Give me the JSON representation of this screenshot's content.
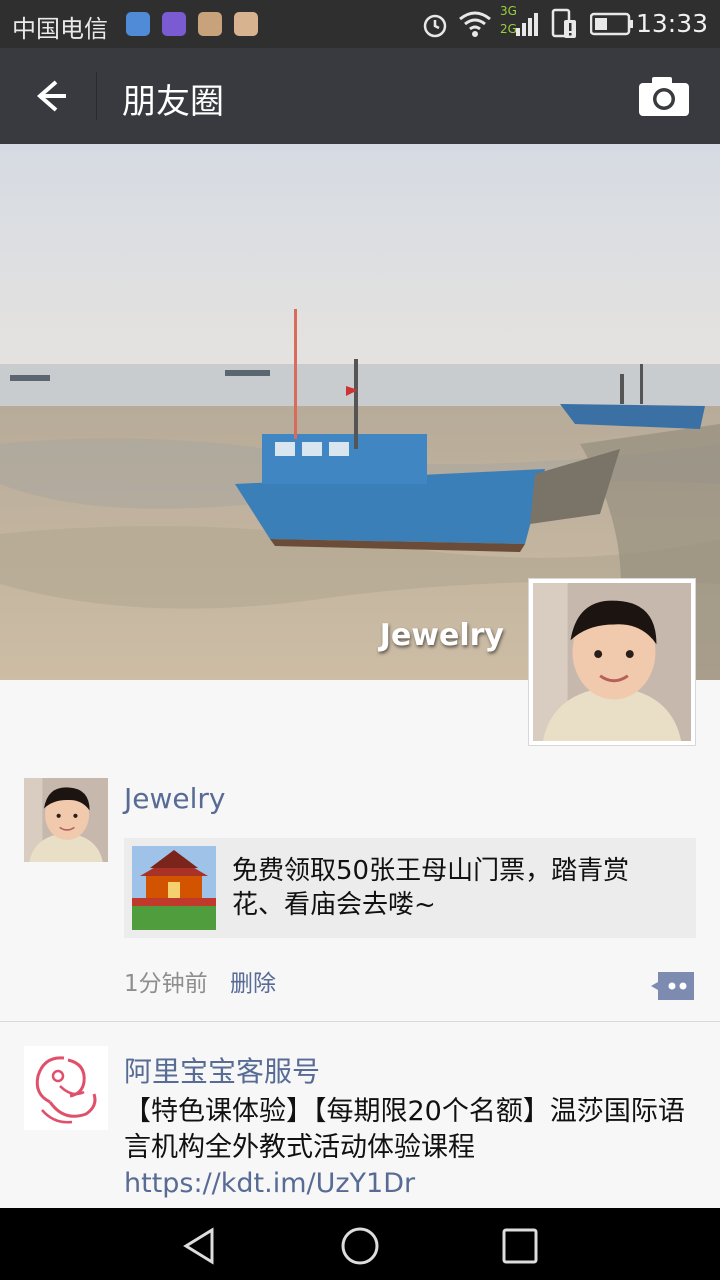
{
  "status": {
    "carrier": "中国电信",
    "time": "13:33",
    "signal_labels": [
      "3G",
      "2G"
    ]
  },
  "header": {
    "title": "朋友圈"
  },
  "cover": {
    "user_name": "Jewelry"
  },
  "posts": [
    {
      "name": "Jewelry",
      "link_title": "免费领取50张王母山门票，踏青赏花、看庙会去喽~",
      "time": "1分钟前",
      "delete_label": "删除"
    },
    {
      "name": "阿里宝宝客服号",
      "text": "【特色课体验】【每期限20个名额】温莎国际语言机构全外教式活动体验课程 ",
      "link": "https://kdt.im/UzY1Dr"
    }
  ],
  "colors": {
    "link_blue": "#576b95",
    "titlebar": "#393a3f",
    "statusbar": "#2f2f30"
  }
}
